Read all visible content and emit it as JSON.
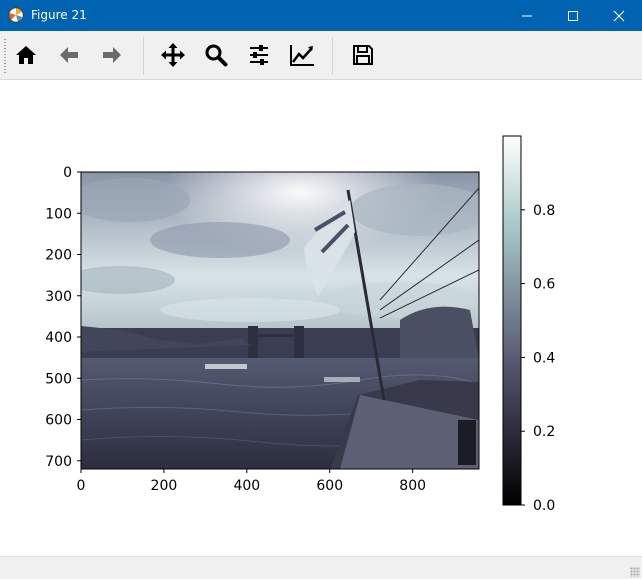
{
  "window": {
    "title": "Figure 21",
    "app_icon": "matplotlib-icon",
    "controls": [
      "minimize-icon",
      "maximize-icon",
      "close-icon"
    ]
  },
  "toolbar": {
    "buttons": [
      {
        "name": "home",
        "icon": "home-icon"
      },
      {
        "name": "back",
        "icon": "arrow-left-icon"
      },
      {
        "name": "forward",
        "icon": "arrow-right-icon"
      },
      {
        "name": "pan",
        "icon": "move-icon"
      },
      {
        "name": "zoom",
        "icon": "magnifier-icon"
      },
      {
        "name": "configure-subplots",
        "icon": "sliders-icon"
      },
      {
        "name": "edit-axes",
        "icon": "line-chart-icon"
      },
      {
        "name": "save",
        "icon": "floppy-disk-icon"
      }
    ]
  },
  "figure": {
    "image_description": "Grayscale-bone colormapped photo of Tower Bridge on the Thames from a ship deck with a flag",
    "colormap": "bone",
    "image_x_ticks": [
      "0",
      "200",
      "400",
      "600",
      "800"
    ],
    "image_y_ticks": [
      "0",
      "100",
      "200",
      "300",
      "400",
      "500",
      "600",
      "700"
    ],
    "colorbar_ticks": [
      "0.0",
      "0.2",
      "0.4",
      "0.6",
      "0.8"
    ],
    "colorbar_range": [
      0.0,
      1.0
    ],
    "image_extent_x": [
      0,
      960
    ],
    "image_extent_y": [
      720,
      0
    ]
  }
}
